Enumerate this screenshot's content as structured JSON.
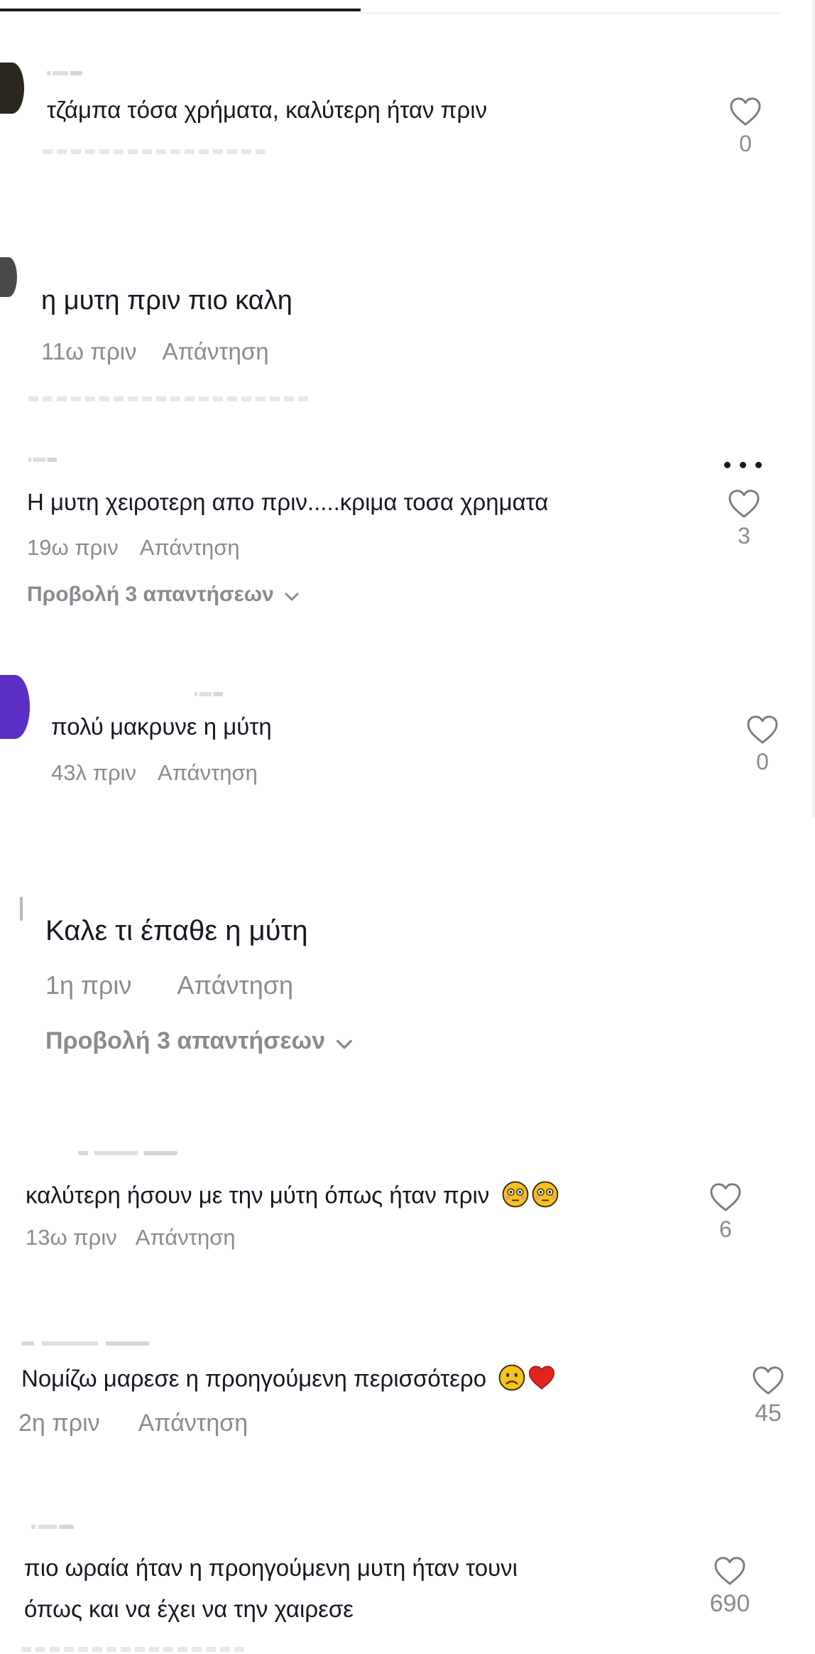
{
  "comments": [
    {
      "text": "τζάμπα τόσα χρήματα, καλύτερη ήταν πριν",
      "likes": "0",
      "avatar_color": "#2b2520"
    },
    {
      "text": "η μυτη πριν πιο καλη",
      "time": "11ω πριν",
      "reply_label": "Απάντηση",
      "avatar_color": "#4a4a4a"
    },
    {
      "text": "Η μυτη χειροτερη απο πριν.....κριμα τοσα χρηματα",
      "time": "19ω πριν",
      "reply_label": "Απάντηση",
      "likes": "3",
      "view_replies": "Προβολή 3 απαντήσεων"
    },
    {
      "text": "πολύ μακρυνε η μύτη",
      "time": "43λ πριν",
      "reply_label": "Απάντηση",
      "likes": "0",
      "avatar_color": "#5b2fc4"
    },
    {
      "text": "Καλε τι έπαθε η μύτη",
      "time": "1η πριν",
      "reply_label": "Απάντηση",
      "view_replies": "Προβολή 3 απαντήσεων",
      "avatar_color": "#b9b9bd"
    },
    {
      "text": "καλύτερη ήσουν με την μύτη όπως ήταν πριν",
      "time": "13ω πριν",
      "reply_label": "Απάντηση",
      "likes": "6",
      "emoji": [
        "flushed-face",
        "flushed-face"
      ]
    },
    {
      "text": "Νομίζω μαρεσε η προηγούμενη περισσότερο",
      "time": "2η πριν",
      "reply_label": "Απάντηση",
      "likes": "45",
      "emoji": [
        "slightly-frowning-face",
        "red-heart"
      ]
    },
    {
      "text_line1": "πιο ωραία ήταν η προηγούμενη μυτη ήταν τουνι",
      "text_line2": "όπως και να έχει να την χαιρεσε",
      "likes": "690"
    }
  ],
  "colors": {
    "text": "#161823",
    "muted": "#8a8b91",
    "heart_stroke": "#7a7b81",
    "emoji_face": "#f7c21f",
    "emoji_heart": "#e0241e"
  }
}
